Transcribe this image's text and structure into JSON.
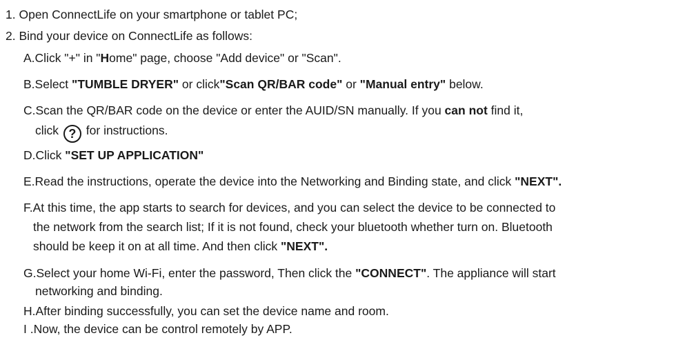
{
  "steps": [
    {
      "label": "1.",
      "text": "Open ConnectLife on your smartphone or tablet PC;"
    },
    {
      "label": "2.",
      "text": "Bind your device on ConnectLife as follows:"
    }
  ],
  "substeps": {
    "a": {
      "p1": "A.Click \"+\" in \"",
      "b1": "H",
      "p2": "ome\" page, choose \"Add device\" or \"Scan\"."
    },
    "b": {
      "p1": "B.Select ",
      "b1": "\"TUMBLE DRYER\"",
      "p2": " or click",
      "b2": "\"Scan QR/BAR code\"",
      "p3": " or ",
      "b3": "\"Manual entry\"",
      "p4": " below."
    },
    "c": {
      "p1": "C.Scan the QR/BAR code on the device or enter the AUID/SN manually. If you ",
      "b1": "can not",
      "p2": " find it,",
      "l2a": "click",
      "icon_glyph": "?",
      "icon_name": "help-circle-icon",
      "l2b": "for instructions."
    },
    "d": {
      "p1": "D.Click ",
      "b1": "\"SET UP APPLICATION\""
    },
    "e": {
      "p1": "E.Read the instructions, operate the device into the Networking and Binding state, and click ",
      "b1": "\"NEXT\"."
    },
    "f": {
      "l1": "F.At this time, the app starts to search for devices, and you can select the device to be connected to",
      "l2": "the network from the search list; If it is not found, check your bluetooth whether turn on. Bluetooth",
      "l3a": "should be keep  it on at all time. And then click ",
      "b1": "\"NEXT\"."
    },
    "g": {
      "p1": "G.Select your home Wi-Fi, enter the password, Then click the ",
      "b1": "\"CONNECT\"",
      "p2": ". The appliance will start",
      "l2": "networking and binding."
    },
    "h": {
      "text": "H.After binding successfully, you can set the device name and room."
    },
    "i": {
      "text": "I .Now, the device can be control remotely by APP."
    }
  }
}
